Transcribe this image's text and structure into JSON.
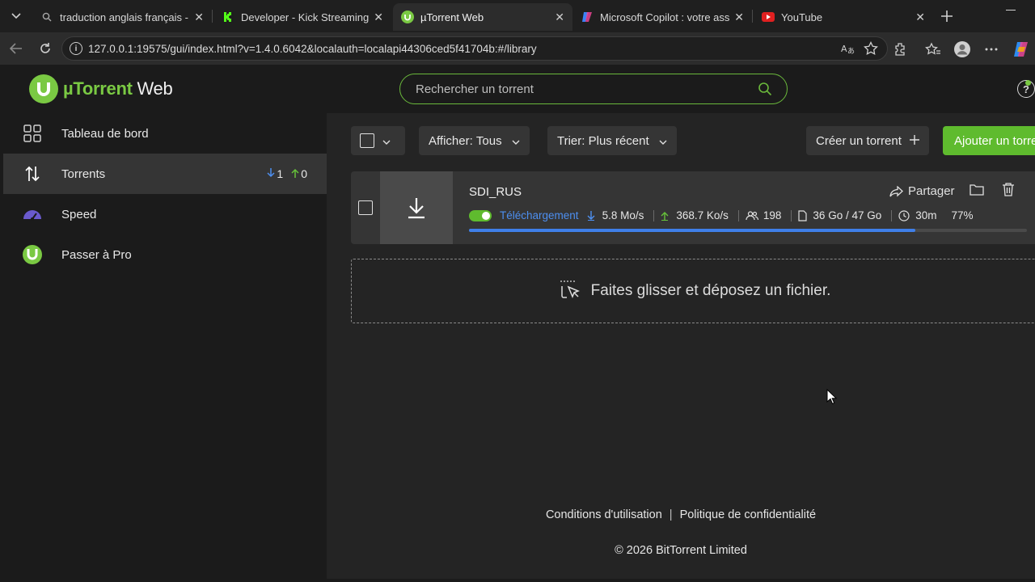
{
  "browser": {
    "tabs": [
      {
        "title": "traduction anglais français - Re",
        "favicon": "search-icon",
        "active": false
      },
      {
        "title": "Developer - Kick Streaming",
        "favicon": "kick-icon",
        "active": false
      },
      {
        "title": "µTorrent Web",
        "favicon": "utorrent-icon",
        "active": true
      },
      {
        "title": "Microsoft Copilot : votre assista",
        "favicon": "copilot-icon",
        "active": false
      },
      {
        "title": "YouTube",
        "favicon": "youtube-icon",
        "active": false
      }
    ],
    "url": "127.0.0.1:19575/gui/index.html?v=1.4.0.6042&localauth=localapi44306ced5f41704b:#/library"
  },
  "app": {
    "logo_brand": "µTorrent",
    "logo_suffix": "Web",
    "search_placeholder": "Rechercher un torrent",
    "accent": "#7ac943"
  },
  "sidebar": {
    "items": [
      {
        "label": "Tableau de bord",
        "icon": "dashboard-icon"
      },
      {
        "label": "Torrents",
        "icon": "transfer-arrows-icon",
        "active": true,
        "down_count": "1",
        "up_count": "0"
      },
      {
        "label": "Speed",
        "icon": "speed-gauge-icon"
      },
      {
        "label": "Passer à Pro",
        "icon": "utorrent-logo-icon"
      }
    ]
  },
  "toolbar": {
    "filter_label": "Afficher:",
    "filter_value": "Tous",
    "sort_label": "Trier:",
    "sort_value": "Plus récent",
    "create_label": "Créer un torrent",
    "add_label": "Ajouter un torrent"
  },
  "torrent": {
    "name": "SDI_RUS",
    "share_label": "Partager",
    "status": "Téléchargement",
    "down_speed": "5.8 Mo/s",
    "up_speed": "368.7 Ko/s",
    "peers": "198",
    "size": "36 Go / 47 Go",
    "eta": "30m",
    "percent": "77%",
    "progress": 0.8,
    "status_color": "#4d8ff0"
  },
  "dropzone": {
    "text": "Faites glisser et déposez un fichier."
  },
  "footer": {
    "terms": "Conditions d'utilisation",
    "separator": "|",
    "privacy": "Politique de confidentialité",
    "copyright": "© 2026 BitTorrent Limited"
  }
}
